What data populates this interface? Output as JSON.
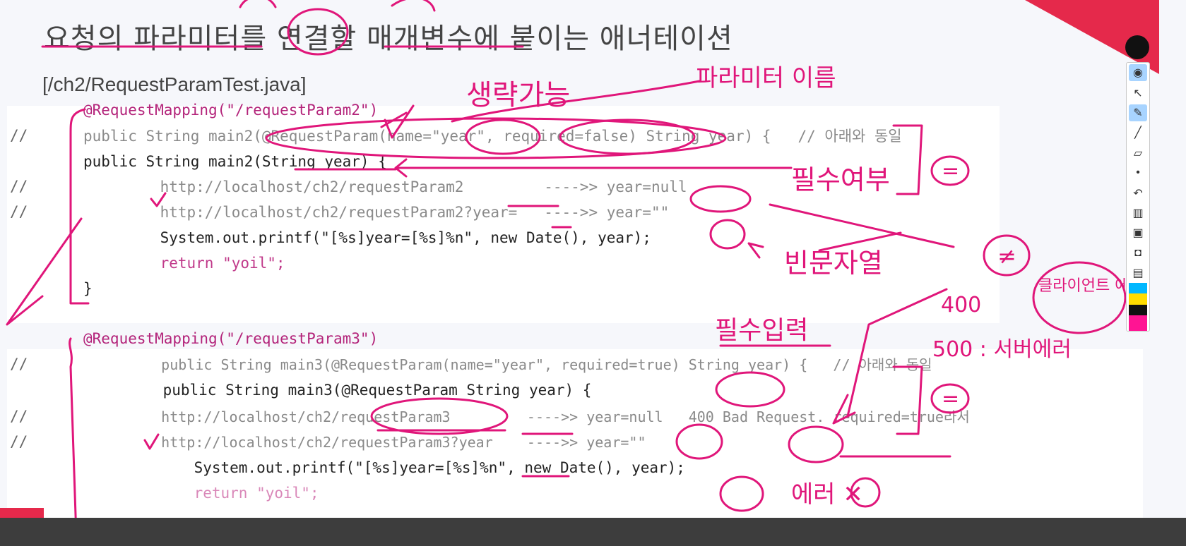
{
  "slide": {
    "title": "요청의 파라미터를 연결할 매개변수에 붙이는 애너테이션",
    "subtitle": "[/ch2/RequestParamTest.java]"
  },
  "code_block_1": {
    "lines": [
      {
        "gutter": "",
        "text": "@RequestMapping(\"/requestParam2\")"
      },
      {
        "gutter": "//",
        "text": "public String main2(@RequestParam(name=\"year\", required=false) String year) {   // 아래와 동일"
      },
      {
        "gutter": "",
        "text": "public String main2(String year) {"
      },
      {
        "gutter": "//",
        "text": "    http://localhost/ch2/requestParam2         ---->> year=null"
      },
      {
        "gutter": "//",
        "text": "    http://localhost/ch2/requestParam2?year=   ---->> year=\"\""
      },
      {
        "gutter": "",
        "text": "    System.out.printf(\"[%s]year=[%s]%n\", new Date(), year);"
      },
      {
        "gutter": "",
        "text": "    return \"yoil\";"
      },
      {
        "gutter": "",
        "text": "}"
      }
    ]
  },
  "code_block_2": {
    "lines": [
      {
        "gutter": "",
        "text": "@RequestMapping(\"/requestParam3\")"
      },
      {
        "gutter": "//",
        "text": "    public String main3(@RequestParam(name=\"year\", required=true) String year) {   // 아래와 동일"
      },
      {
        "gutter": "",
        "text": "    public String main3(@RequestParam String year) {"
      },
      {
        "gutter": "//",
        "text": "    http://localhost/ch2/requestParam3         ---->> year=null   400 Bad Request. required=true라서"
      },
      {
        "gutter": "//",
        "text": "    http://localhost/ch2/requestParam3?year    ---->> year=\"\""
      },
      {
        "gutter": "",
        "text": "    System.out.printf(\"[%s]year=[%s]%n\", new Date(), year);"
      },
      {
        "gutter": "",
        "text": "    return \"yoil\";"
      }
    ]
  },
  "handwritten_notes": {
    "omittable": "생략가능",
    "param_name": "파라미터 이름",
    "required_flag": "필수여부",
    "empty_string": "빈문자열",
    "required_input": "필수입력",
    "client_error": "클라이언트 에러",
    "code_400": "400",
    "code_500": "500 : 서버에러",
    "error_x": "에러 ✕",
    "equals_1": "=",
    "equals_2": "=",
    "not_equal": "≠"
  },
  "toolbar": {
    "tools": [
      "eye-icon",
      "pointer-icon",
      "highlighter-icon",
      "pen-icon",
      "eraser-icon",
      "dot-icon",
      "undo-icon",
      "trash-icon",
      "screen-icon",
      "camera-icon",
      "clipboard-icon"
    ],
    "colors": [
      "#00b7ff",
      "#ffdd00",
      "#111111",
      "#ff1493"
    ]
  },
  "theme": {
    "annotation_color": "#e0167a",
    "accent_red": "#e5294b"
  }
}
